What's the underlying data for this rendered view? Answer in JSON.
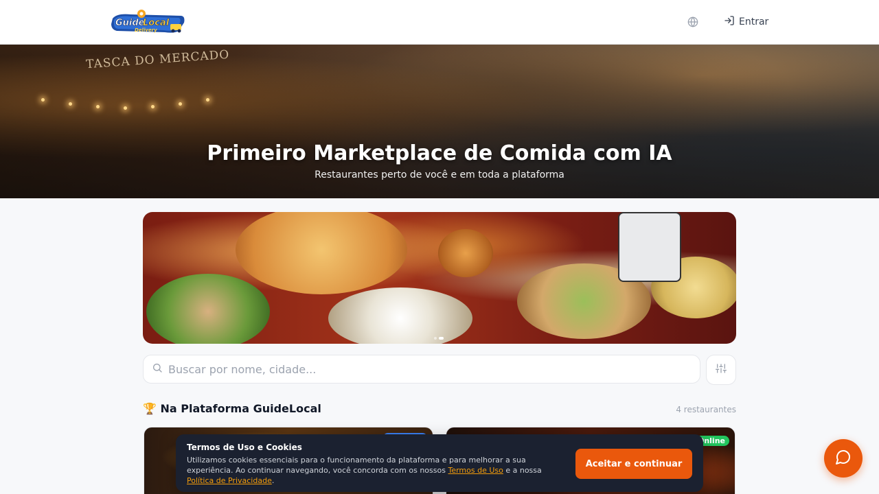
{
  "header": {
    "logo_text_1": "Guide",
    "logo_text_2": "Local",
    "logo_text_3": "Delivery",
    "language_icon": "globe-icon",
    "login_icon": "log-in-icon",
    "login_label": "Entrar"
  },
  "hero": {
    "sign_text": "TASCA DO MERCADO",
    "title": "Primeiro Marketplace de Comida com IA",
    "subtitle": "Restaurantes perto de você e em toda a plataforma"
  },
  "banner": {
    "slides": 2,
    "active_slide": 2
  },
  "search": {
    "placeholder": "Buscar por nome, cidade...",
    "value": "",
    "search_icon": "search-icon",
    "filter_icon": "sliders-icon"
  },
  "section": {
    "emoji": "🏆",
    "title": "Na Plataforma GuideLocal",
    "count": "4 restaurantes"
  },
  "cards": [
    {
      "badge": "",
      "badge_color": "#3b82f6"
    },
    {
      "badge": "Online",
      "badge_color": "#22c55e"
    }
  ],
  "cookie": {
    "title": "Termos de Uso e Cookies",
    "text_1": "Utilizamos cookies essenciais para o funcionamento da plataforma e para melhorar a sua experiência. Ao continuar navegando, você concorda com os nossos ",
    "terms_link": "Termos de Uso",
    "text_2": " e a nossa ",
    "privacy_link": "Política de Privacidade",
    "text_3": ".",
    "accept_label": "Aceitar e continuar"
  },
  "chat": {
    "icon": "message-circle-icon"
  },
  "colors": {
    "accent": "#ea580c",
    "online": "#22c55e",
    "link": "#f59e0b"
  }
}
